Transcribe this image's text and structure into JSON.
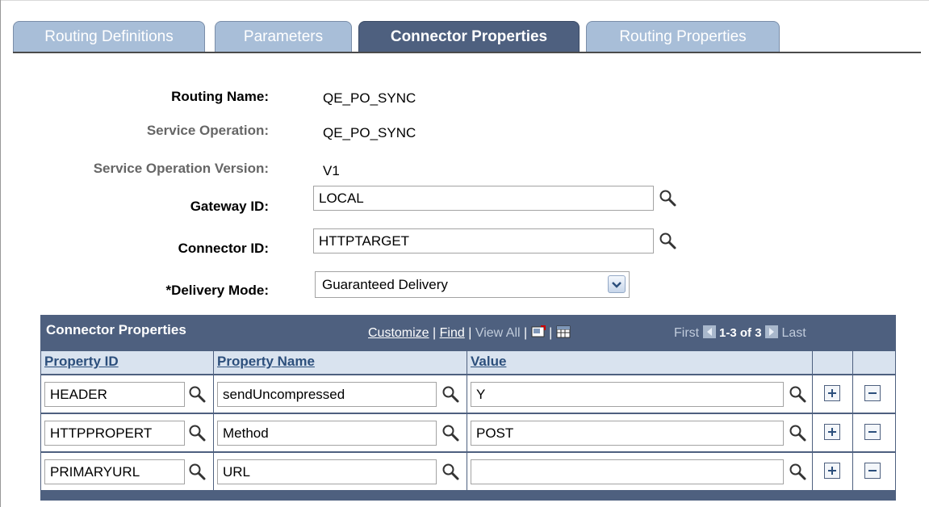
{
  "tabs": [
    {
      "label": "Routing Definitions"
    },
    {
      "label": "Parameters"
    },
    {
      "label": "Connector Properties"
    },
    {
      "label": "Routing Properties"
    }
  ],
  "form": {
    "routing_name_label": "Routing Name:",
    "routing_name_value": "QE_PO_SYNC",
    "service_operation_label": "Service Operation:",
    "service_operation_value": "QE_PO_SYNC",
    "service_operation_version_label": "Service Operation Version:",
    "service_operation_version_value": "V1",
    "gateway_id_label": "Gateway ID:",
    "gateway_id_value": "LOCAL",
    "connector_id_label": "Connector ID:",
    "connector_id_value": "HTTPTARGET",
    "delivery_mode_label": "*Delivery Mode:",
    "delivery_mode_value": "Guaranteed Delivery"
  },
  "grid": {
    "title": "Connector Properties",
    "customize": "Customize",
    "find": "Find",
    "view_all": "View All",
    "first": "First",
    "count": "1-3 of 3",
    "last": "Last",
    "columns": [
      "Property ID",
      "Property Name",
      "Value"
    ],
    "rows": [
      {
        "property_id": "HEADER",
        "property_name": "sendUncompressed",
        "value": "Y"
      },
      {
        "property_id": "HTTPPROPERT",
        "property_name": "Method",
        "value": "POST"
      },
      {
        "property_id": "PRIMARYURL",
        "property_name": "URL",
        "value": ""
      }
    ]
  },
  "icons": {
    "lookup": "magnifier-icon",
    "add_row": "plus-icon",
    "delete_row": "minus-icon",
    "zoom": "zoom-grid-icon",
    "download": "download-spreadsheet-icon"
  },
  "colors": {
    "tab_active": "#4e607f",
    "tab_inactive": "#a8bed8",
    "grid_header": "#4e607f",
    "column_header": "#d9e3ef"
  }
}
